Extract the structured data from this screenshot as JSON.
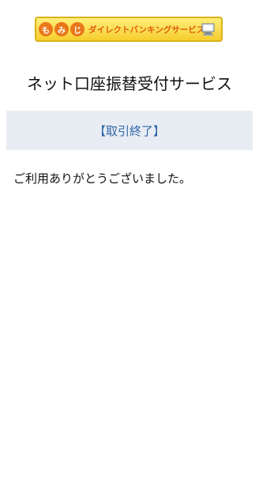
{
  "banner": {
    "badge_1": "も",
    "badge_2": "み",
    "badge_3": "じ",
    "text": "ダイレクトバンキングサービス",
    "icon": "computer-icon"
  },
  "page": {
    "title": "ネット口座振替受付サービス",
    "status": "【取引終了】",
    "message": "ご利用ありがとうございました。"
  },
  "colors": {
    "accent": "#2f66a8",
    "band": "#e8edf3",
    "banner_border": "#d8b21b",
    "banner_text": "#e05c10"
  }
}
